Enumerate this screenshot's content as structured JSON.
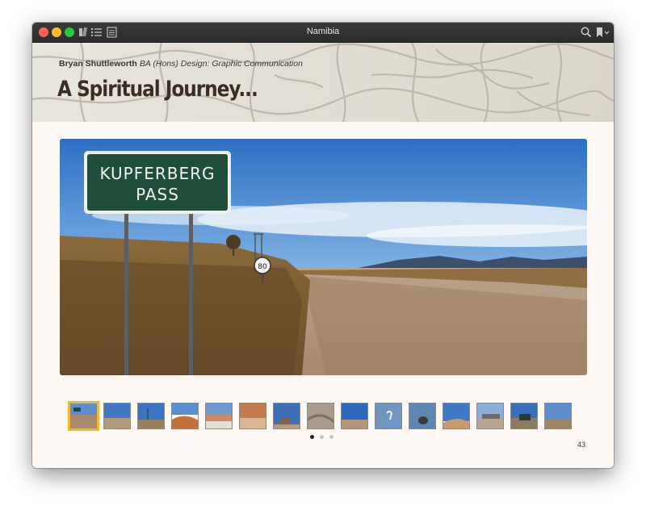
{
  "window": {
    "title": "Namibia"
  },
  "header": {
    "author_name": "Bryan Shuttleworth",
    "author_degree": "BA (Hons) Design: Graphic Communication",
    "book_title": "A Spiritual Journey..."
  },
  "photo": {
    "sign_line1": "KUPFERBERG",
    "sign_line2": "PASS",
    "speed_sign": "80"
  },
  "thumbnails": {
    "count": 15,
    "selected_index": 0,
    "items": [
      "road-sign",
      "desert-plain",
      "tree-blue-sky",
      "red-dunes",
      "salt-pan",
      "red-sand",
      "rock-dome",
      "dry-riverbed",
      "open-landscape",
      "flamingo-water",
      "seal-water",
      "dune-sky",
      "table-mountain",
      "truck-scene",
      "plain-horizon"
    ]
  },
  "pagination": {
    "dots": 3,
    "active": 0
  },
  "page_number": "43"
}
